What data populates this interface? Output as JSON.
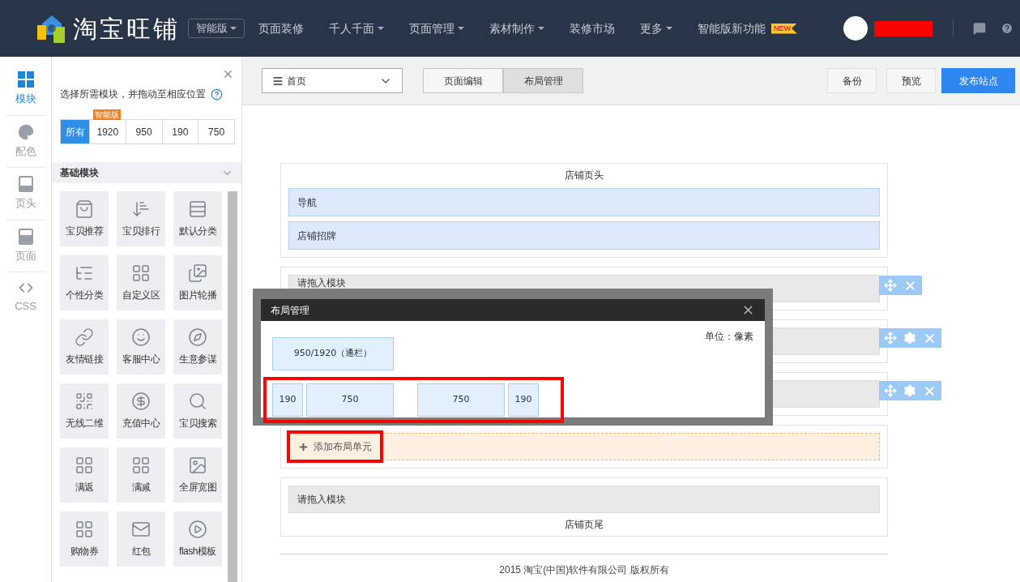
{
  "topbar": {
    "logo_text": "淘宝旺铺",
    "edition": "智能版",
    "nav": [
      {
        "label": "页面装修",
        "has_menu": false
      },
      {
        "label": "千人千面",
        "has_menu": true
      },
      {
        "label": "页面管理",
        "has_menu": true
      },
      {
        "label": "素材制作",
        "has_menu": true
      },
      {
        "label": "装修市场",
        "has_menu": false
      },
      {
        "label": "更多",
        "has_menu": true
      },
      {
        "label": "智能版新功能",
        "has_menu": false,
        "badge": "NEW"
      }
    ]
  },
  "rail": [
    {
      "label": "模块",
      "selected": true
    },
    {
      "label": "配色",
      "selected": false
    },
    {
      "label": "页头",
      "selected": false
    },
    {
      "label": "页面",
      "selected": false
    },
    {
      "label": "CSS",
      "selected": false
    }
  ],
  "panel": {
    "hint": "选择所需模块，并拖动至相应位置",
    "filters": [
      {
        "label": "所有",
        "selected": true
      },
      {
        "label": "1920",
        "selected": false,
        "badge": "智能版"
      },
      {
        "label": "950",
        "selected": false
      },
      {
        "label": "190",
        "selected": false
      },
      {
        "label": "750",
        "selected": false
      }
    ],
    "section_title": "基础模块",
    "modules": [
      "宝贝推荐",
      "宝贝排行",
      "默认分类",
      "个性分类",
      "自定义区",
      "图片轮播",
      "友情链接",
      "客服中心",
      "生意参谋",
      "无线二维",
      "充值中心",
      "宝贝搜索",
      "满返",
      "满减",
      "全屏宽图",
      "购物券",
      "红包",
      "flash模板"
    ]
  },
  "toolbar": {
    "page_select": "首页",
    "tabs": [
      {
        "label": "页面编辑",
        "selected": false
      },
      {
        "label": "布局管理",
        "selected": true
      }
    ],
    "buttons": [
      {
        "label": "备份",
        "kind": "plain"
      },
      {
        "label": "预览",
        "kind": "plain"
      },
      {
        "label": "发布站点",
        "kind": "primary"
      }
    ]
  },
  "sections": [
    {
      "kind": "header",
      "title": "店铺页头",
      "rows": [
        "导航",
        "店铺招牌"
      ]
    },
    {
      "kind": "slot",
      "label": "请拖入模块",
      "has_settings": false
    },
    {
      "kind": "slot",
      "has_settings": true
    },
    {
      "kind": "slot",
      "has_settings": true
    },
    {
      "kind": "add",
      "label": "添加布局单元",
      "highlighted": true
    },
    {
      "kind": "footer",
      "label": "请拖入模块",
      "title": "店铺页尾"
    }
  ],
  "copyright": "2015 淘宝(中国)软件有限公司 版权所有",
  "dialog": {
    "title": "布局管理",
    "unit": "单位：像素",
    "layouts": [
      {
        "highlighted": false,
        "groups": [
          [
            {
              "label": "950/1920（通栏）",
              "kind": "full"
            }
          ]
        ]
      },
      {
        "highlighted": true,
        "groups": [
          [
            {
              "label": "190",
              "kind": "narrow"
            },
            {
              "label": "750",
              "kind": "wide"
            }
          ],
          [
            {
              "label": "750",
              "kind": "wide"
            },
            {
              "label": "190",
              "kind": "narrow"
            }
          ]
        ]
      }
    ]
  }
}
